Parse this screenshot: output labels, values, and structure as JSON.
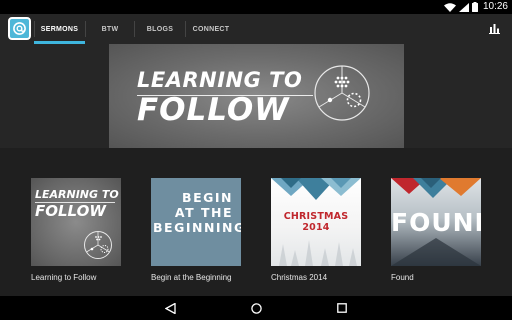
{
  "status_bar": {
    "time": "10:26",
    "icons": [
      "wifi-icon",
      "signal-icon",
      "battery-icon"
    ]
  },
  "app_bar": {
    "logo_icon": "app-logo-icon",
    "tabs": [
      {
        "label": "SERMONS",
        "active": true
      },
      {
        "label": "BTW",
        "active": false
      },
      {
        "label": "BLOGS",
        "active": false
      },
      {
        "label": "CONNECT",
        "active": false
      }
    ],
    "action_icon": "analytics-icon"
  },
  "hero": {
    "line1": "LEARNING TO",
    "line2": "FOLLOW"
  },
  "series": [
    {
      "title": "Learning to Follow",
      "art_line1": "LEARNING TO",
      "art_line2": "FOLLOW"
    },
    {
      "title": "Begin at the Beginning",
      "art_lines": [
        "BEGIN",
        "AT THE",
        "BEGINNING"
      ]
    },
    {
      "title": "Christmas 2014",
      "art_text": "CHRISTMAS 2014"
    },
    {
      "title": "Found",
      "art_text": "FOUND"
    }
  ],
  "colors": {
    "accent": "#3fb6de",
    "app_bar": "#262626",
    "content_bg": "#1f1f1f",
    "christmas_red": "#c0272d"
  },
  "nav_bar": {
    "icons": [
      "back-icon",
      "home-icon",
      "recents-icon"
    ]
  }
}
